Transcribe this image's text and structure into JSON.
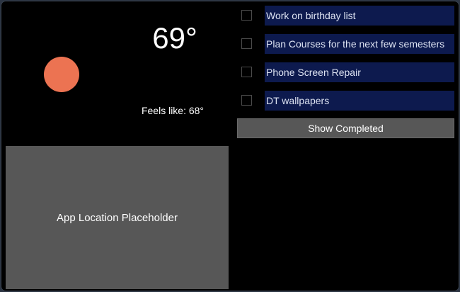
{
  "weather": {
    "temperature": "69°",
    "feels_like": "Feels like: 68°",
    "icon": "sun-icon",
    "icon_color": "#ec7352"
  },
  "location": {
    "placeholder_text": "App Location Placeholder"
  },
  "tasks": {
    "items": [
      {
        "label": "Work on birthday list",
        "checked": false
      },
      {
        "label": "Plan Courses for the next few semesters",
        "checked": false
      },
      {
        "label": "Phone Screen Repair",
        "checked": false
      },
      {
        "label": "DT wallpapers",
        "checked": false
      }
    ],
    "show_completed_label": "Show Completed"
  },
  "colors": {
    "background": "#000000",
    "task_label_background": "#0d1a4e",
    "button_background": "#575757"
  }
}
